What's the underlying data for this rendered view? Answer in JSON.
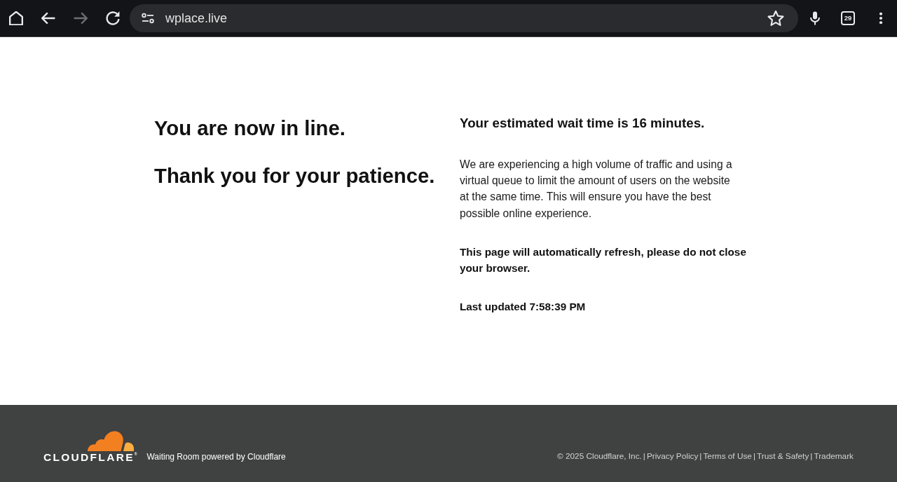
{
  "toolbar": {
    "nav_buttons": [
      {
        "kind": "home",
        "disabled": false
      },
      {
        "kind": "back",
        "disabled": false
      },
      {
        "kind": "forward",
        "disabled": true
      },
      {
        "kind": "reload",
        "disabled": false
      }
    ],
    "address_bar": {
      "url": "wplace.live"
    },
    "tab_count": "29"
  },
  "queue": {
    "headings": [
      "You are now in line.",
      "Thank you for your patience."
    ],
    "wait_time": "Your estimated wait time is 16 minutes.",
    "paragraphs": [
      {
        "text": "We are experiencing a high volume of traffic and using a virtual queue to limit the amount of users on the website at the same time. This will ensure you have the best possible online experience.",
        "bold": false
      },
      {
        "text": "This page will automatically refresh, please do not close your browser.",
        "bold": true
      },
      {
        "text": "Last updated 7:58:39 PM",
        "bold": true
      }
    ]
  },
  "footer": {
    "logo_text": "CLOUDFLARE$^{®}$",
    "powered_by": "Waiting Room powered by Cloudflare",
    "legal": [
      {
        "kind": "text",
        "text": "© 2025 Cloudflare, Inc."
      },
      {
        "kind": "separator",
        "text": "|"
      },
      {
        "kind": "link",
        "text": "Privacy Policy"
      },
      {
        "kind": "separator",
        "text": "|"
      },
      {
        "kind": "link",
        "text": "Terms of Use"
      },
      {
        "kind": "separator",
        "text": "|"
      },
      {
        "kind": "link",
        "text": "Trust & Safety"
      },
      {
        "kind": "separator",
        "text": "|"
      },
      {
        "kind": "link",
        "text": "Trademark"
      }
    ]
  }
}
